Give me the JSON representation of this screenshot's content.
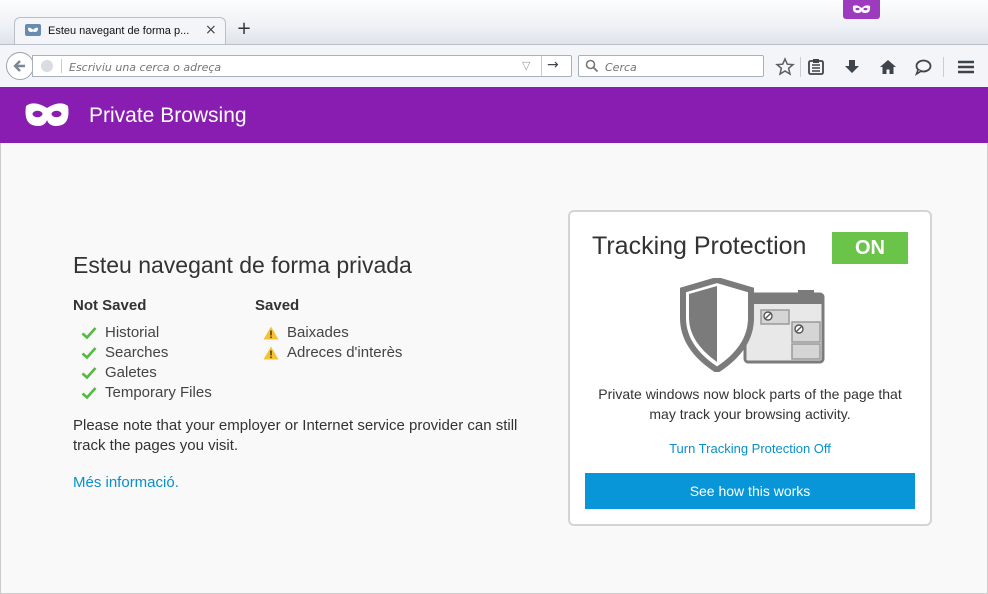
{
  "colors": {
    "accent": "#8a1db1",
    "on_badge": "#6bc44a",
    "link": "#0a90c8",
    "button": "#0996d8"
  },
  "tab": {
    "title": "Esteu navegant de forma p...",
    "close_label": "×"
  },
  "new_tab_label": "+",
  "url_bar": {
    "placeholder": "Escriviu una cerca o adreça"
  },
  "search_bar": {
    "placeholder": "Cerca"
  },
  "toolbar_icons": [
    "bookmark-star-icon",
    "reading-list-icon",
    "download-icon",
    "home-icon",
    "chat-icon",
    "menu-icon"
  ],
  "header": {
    "title": "Private Browsing"
  },
  "main": {
    "title": "Esteu navegant de forma privada",
    "not_saved": {
      "heading": "Not Saved",
      "items": [
        "Historial",
        "Searches",
        "Galetes",
        "Temporary Files"
      ]
    },
    "saved": {
      "heading": "Saved",
      "items": [
        "Baixades",
        "Adreces d'interès"
      ]
    },
    "note": "Please note that your employer or Internet service provider can still track the pages you visit.",
    "more_info": "Més informació."
  },
  "tracking": {
    "title": "Tracking Protection",
    "status": "ON",
    "description": "Private windows now block parts of the page that may track your browsing activity.",
    "turn_off": "Turn Tracking Protection Off",
    "see_how": "See how this works"
  }
}
